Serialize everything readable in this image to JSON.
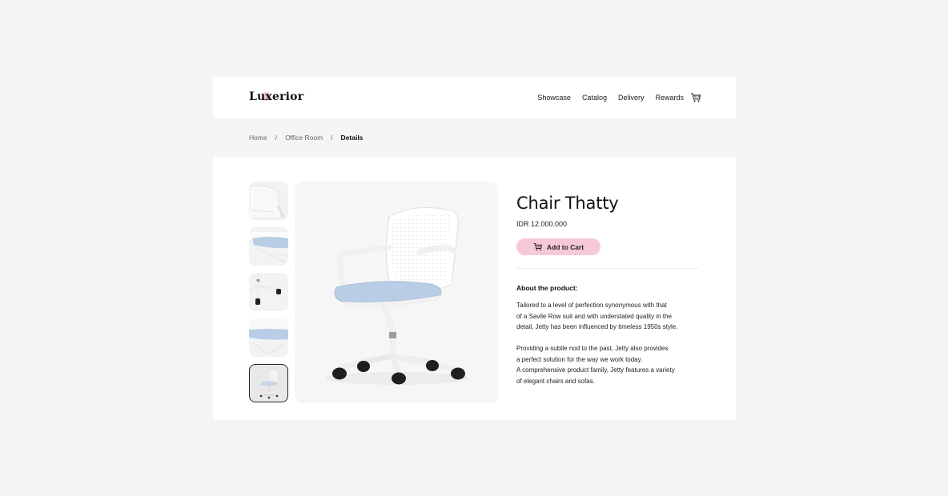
{
  "brand": {
    "name": "Luxerior"
  },
  "nav": {
    "items": [
      "Showcase",
      "Catalog",
      "Delivery",
      "Rewards"
    ],
    "cart_icon": "cart-icon"
  },
  "breadcrumb": {
    "items": [
      "Home",
      "Office Room",
      "Details"
    ],
    "separator": "/"
  },
  "product": {
    "title": "Chair Thatty",
    "price": "IDR 12.000.000",
    "add_to_cart_label": "Add to Cart",
    "about_heading": "About the product:",
    "description": [
      "Tailored to a level of perfection synonymous with that\nof a Savile Row suit and with understated quality in the\ndetail, Jetty has been influenced by timeless 1950s style.",
      "Providing a subtle nod to the past, Jetty also provides\na perfect solution for the way we work today.\nA comprehensive product family, Jetty features a variety\nof elegant chairs and sofas."
    ],
    "thumbnails": [
      {
        "name": "chair-backrest-detail"
      },
      {
        "name": "chair-seat-detail"
      },
      {
        "name": "chair-base-wheels-detail"
      },
      {
        "name": "chair-seat-closeup"
      },
      {
        "name": "chair-full-view",
        "active": true
      }
    ]
  },
  "colors": {
    "accent_pink": "#f7c9d8",
    "page_bg": "#f4f4f4",
    "seat_blue": "#b9cde6"
  }
}
